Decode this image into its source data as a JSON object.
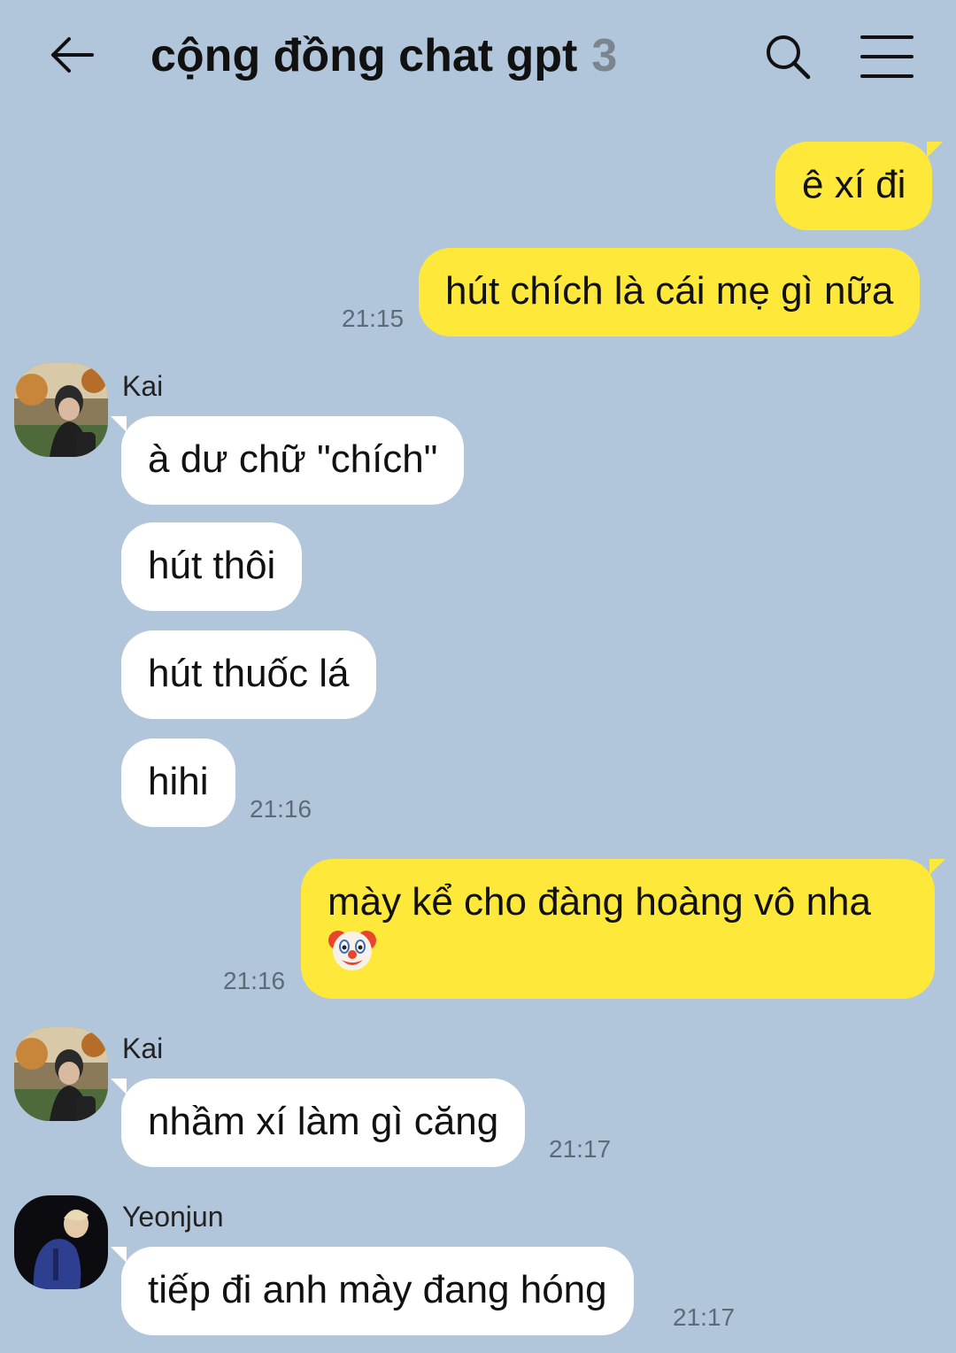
{
  "header": {
    "title": "cộng đồng chat gpt",
    "member_count": "3"
  },
  "messages": [
    {
      "direction": "out",
      "text": "ê xí đi"
    },
    {
      "direction": "out",
      "text": "hút chích là cái mẹ gì nữa",
      "time": "21:15"
    },
    {
      "direction": "in",
      "sender": "Kai",
      "text": "à dư chữ \"chích\""
    },
    {
      "direction": "in",
      "text": "hút thôi"
    },
    {
      "direction": "in",
      "text": "hút thuốc lá"
    },
    {
      "direction": "in",
      "text": "hihi",
      "time": "21:16"
    },
    {
      "direction": "out",
      "text_line1": "mày kể cho đàng hoàng vô nha",
      "emoji": "clown-face-icon",
      "time": "21:16"
    },
    {
      "direction": "in",
      "sender": "Kai",
      "text": "nhầm xí làm gì căng",
      "time": "21:17"
    },
    {
      "direction": "in",
      "sender": "Yeonjun",
      "text": "tiếp đi anh mày đang hóng",
      "time": "21:17"
    }
  ],
  "colors": {
    "background": "#b1c6da",
    "outgoing_bubble": "#fee83a",
    "incoming_bubble": "#ffffff",
    "timestamp": "#5d6b78"
  }
}
